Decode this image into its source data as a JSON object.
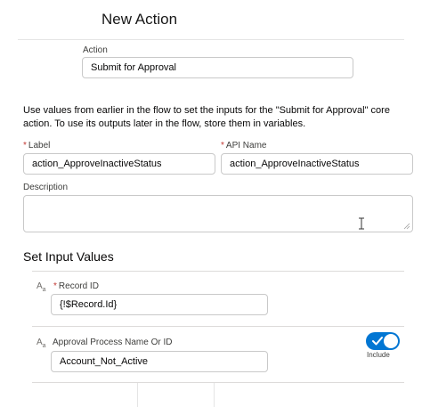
{
  "modal": {
    "title": "New Action"
  },
  "action": {
    "label": "Action",
    "value": "Submit for Approval"
  },
  "help_text": "Use values from earlier in the flow to set the inputs for the \"Submit for Approval\" core action. To use its outputs later in the flow, store them in variables.",
  "fields": {
    "label": {
      "label": "Label",
      "required_mark": "*",
      "value": "action_ApproveInactiveStatus"
    },
    "api_name": {
      "label": "API Name",
      "required_mark": "*",
      "value": "action_ApproveInactiveStatus"
    },
    "description": {
      "label": "Description",
      "value": ""
    }
  },
  "input_values": {
    "title": "Set Input Values",
    "type_icon_main": "A",
    "type_icon_sub": "a",
    "record_id": {
      "label": "Record ID",
      "required_mark": "*",
      "value": "{!$Record.Id}",
      "icon": "text-type-icon"
    },
    "approval_process": {
      "label": "Approval Process Name Or ID",
      "value": "Account_Not_Active",
      "icon": "text-type-icon",
      "include_label": "Include",
      "include_on": true
    }
  },
  "colors": {
    "accent": "#0176d3",
    "required": "#c23934",
    "border": "#c9c9c9"
  }
}
